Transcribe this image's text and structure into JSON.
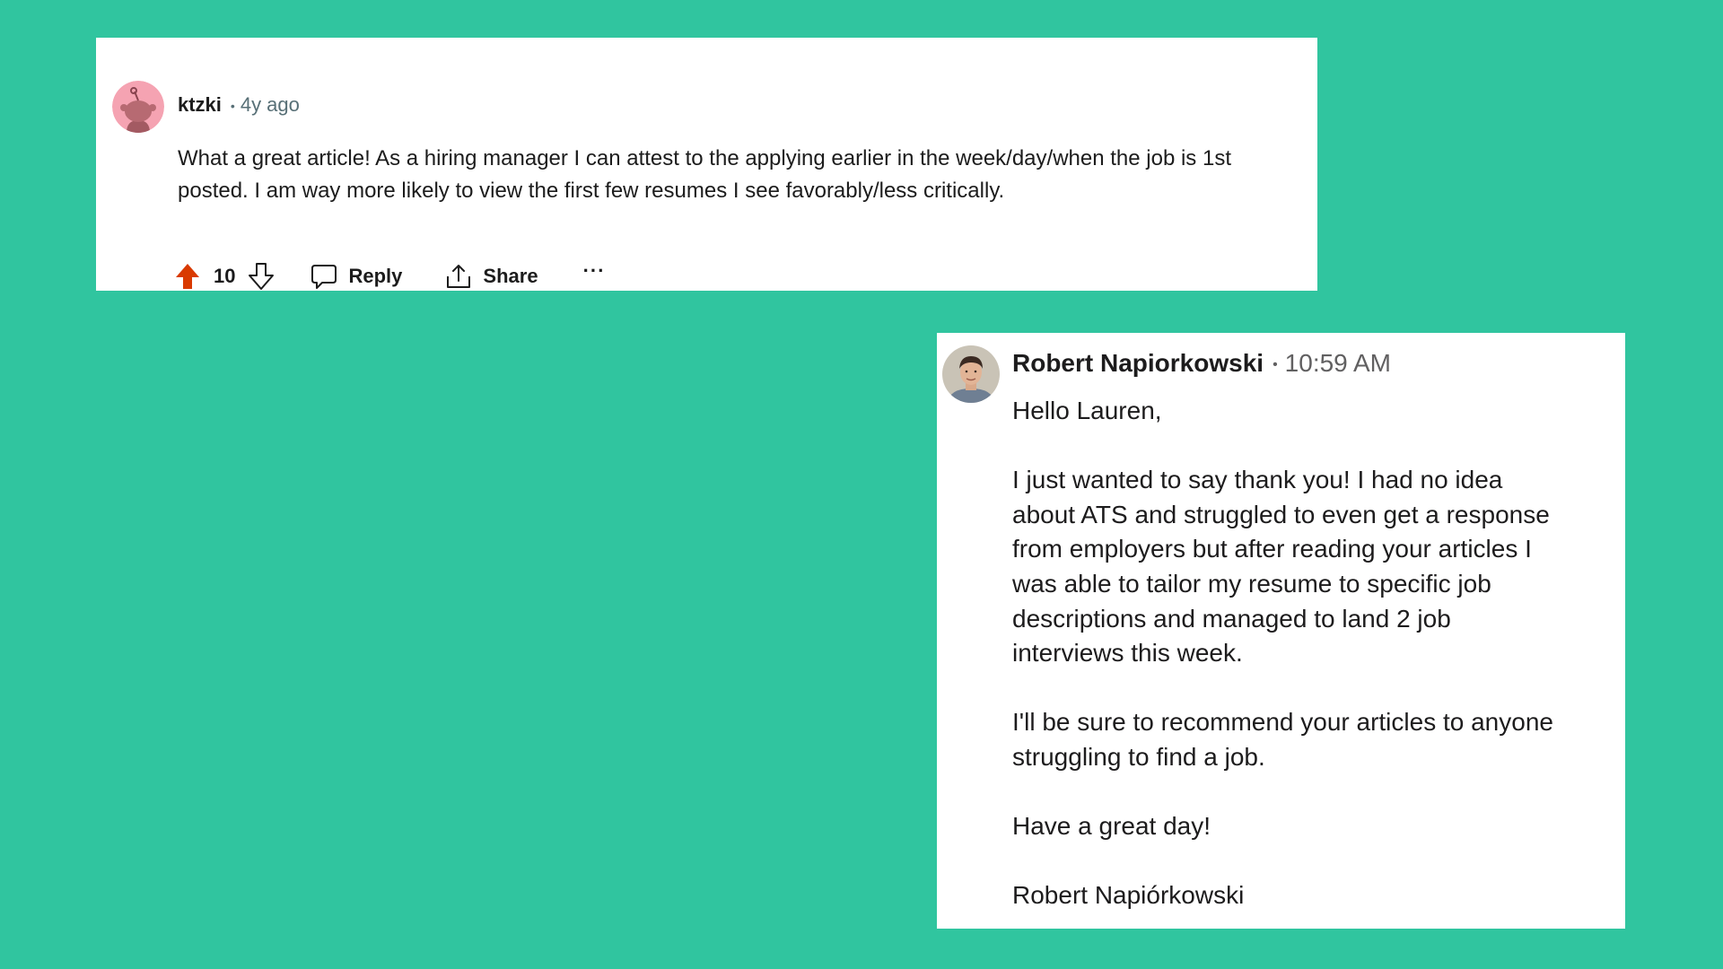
{
  "colors": {
    "background": "#30c59f",
    "card": "#ffffff",
    "upvote_active": "#d93a00",
    "reddit_avatar": "#f5a3b2",
    "meta_gray": "#576f76"
  },
  "reddit_comment": {
    "username": "ktzki",
    "separator": "•",
    "age": "4y ago",
    "body": "What a great article! As a hiring manager I can attest to the applying earlier in the week/day/when the job is 1st posted. I am way more likely to view the first few resumes I see favorably/less critically.",
    "vote_count": "10",
    "reply_label": "Reply",
    "share_label": "Share",
    "more_label": "···",
    "icons": [
      "snoo-avatar-icon",
      "upvote-filled-icon",
      "downvote-icon",
      "comment-bubble-icon",
      "share-upload-icon",
      "more-dots-icon"
    ]
  },
  "message": {
    "sender": "Robert Napiorkowski",
    "separator": "•",
    "time": "10:59 AM",
    "paragraphs": [
      "Hello Lauren,",
      "I just wanted to say thank you! I had no idea about ATS and struggled to even get a response from employers but after reading your articles I was able to tailor my resume to specific job descriptions and managed to land 2 job interviews this week.",
      "I'll be sure to recommend your articles to anyone struggling to find a job.",
      "Have a great day!",
      "Robert Napiórkowski"
    ],
    "icons": [
      "profile-photo-avatar"
    ]
  }
}
